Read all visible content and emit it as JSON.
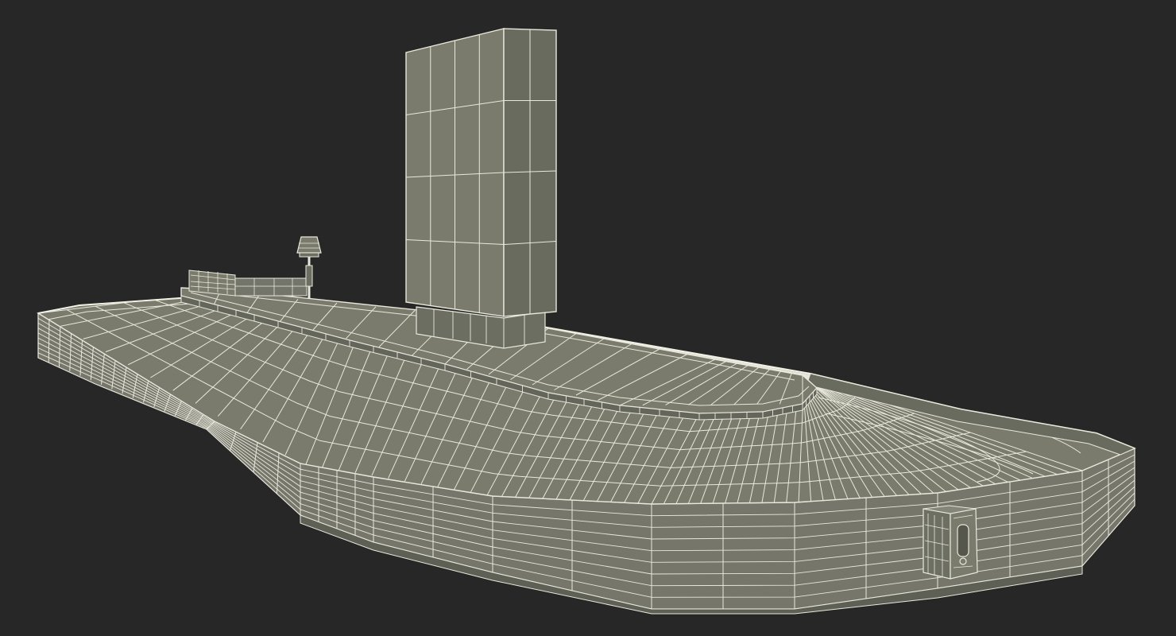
{
  "scene": {
    "subject": "baggage-carousel-wireframe",
    "background_color": "#272727",
    "surface_color": "#7b7c6c",
    "surface_dark_color": "#63645a",
    "wire_color": "#e8e8dc"
  }
}
